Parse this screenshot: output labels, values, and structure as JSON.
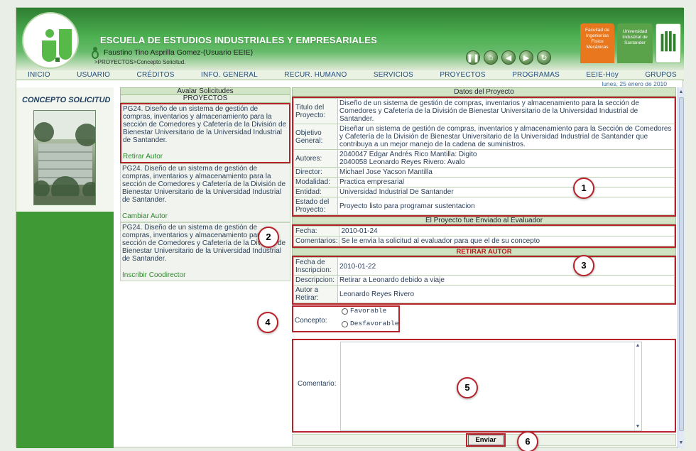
{
  "header": {
    "school_title": "ESCUELA DE ESTUDIOS INDUSTRIALES Y EMPRESARIALES",
    "user_line": "Faustino Tino Asprilla Gomez-(Usuario EEIE)",
    "breadcrumb": ">PROYECTOS>Concepto Solicitud.",
    "faculty_badge": "Facultad de Ingenierías Físico Mecánicas",
    "university_badge": "Universidad Industrial de Santander"
  },
  "menu": [
    "INICIO",
    "USUARIO",
    "CRÉDITOS",
    "INFO. GENERAL",
    "RECUR. HUMANO",
    "SERVICIOS",
    "PROYECTOS",
    "PROGRAMAS",
    "EEIE-Hoy",
    "GRUPOS"
  ],
  "date": "lunes, 25 enero de 2010",
  "sidebar": {
    "title": "CONCEPTO SOLICITUD"
  },
  "middle": {
    "header": "Avalar Solicitudes",
    "subheader": "PROYECTOS",
    "items": [
      {
        "text": "PG24. Diseño de un sistema de gestión de compras, inventarios y almacenamiento para la sección de Comedores y Cafetería de la División de Bienestar Universitario de la Universidad Industrial de Santander.",
        "link": "Retirar Autor"
      },
      {
        "text": "PG24. Diseño de un sistema de gestión de compras, inventarios y almacenamiento para la sección de Comedores y Cafetería de la División de Bienestar Universitario de la Universidad Industrial de Santander.",
        "link": "Cambiar Autor"
      },
      {
        "text": "PG24. Diseño de un sistema de gestión de compras, inventarios y almacenamiento para la sección de Comedores y Cafetería de la División de Bienestar Universitario de la Universidad Industrial de Santander.",
        "link": "Inscribir Coodirector"
      }
    ]
  },
  "project": {
    "header": "Datos del Proyecto",
    "rows": [
      {
        "label": "Titulo del Proyecto:",
        "value": "Diseño de un sistema de gestión de compras, inventarios y almacenamiento para la sección de Comedores y Cafetería de la División de Bienestar Universitario de la Universidad Industrial de Santander."
      },
      {
        "label": "Objetivo General:",
        "value": "Diseñar un sistema de gestión de compras, inventarios y almacenamiento para la Sección de Comedores y Cafetería de la División de Bienestar Universitario de la Universidad Industrial de Santander que contribuya a un mejor manejo de la cadena de suministros."
      },
      {
        "label": "Autores:",
        "value_lines": [
          "2040047 Edgar Andrés Rico Mantilla: Digito",
          "2040058 Leonardo Reyes Rivero: Avalo"
        ]
      },
      {
        "label": "Director:",
        "value": "Michael Jose Yacson Mantilla"
      },
      {
        "label": "Modalidad:",
        "value": "Practica empresarial"
      },
      {
        "label": "Entidad:",
        "value": "Universidad Industrial De Santander"
      },
      {
        "label": "Estado del Proyecto:",
        "value": "Proyecto listo para programar sustentacion"
      }
    ]
  },
  "evaluator": {
    "header": "El Proyecto fue Enviado al Evaluador",
    "fecha_label": "Fecha:",
    "fecha": "2010-01-24",
    "comentarios_label": "Comentarios:",
    "comentarios": "Se le envia la solicitud al evaluador para que el de su concepto"
  },
  "retirar": {
    "header": "RETIRAR AUTOR",
    "fecha_label": "Fecha de Inscripcion:",
    "fecha": "2010-01-22",
    "descripcion_label": "Descripcion:",
    "descripcion": "Retirar a Leonardo debido a viaje",
    "autor_label": "Autor a Retirar:",
    "autor": "Leonardo Reyes Rivero"
  },
  "concepto": {
    "label": "Concepto:",
    "options": [
      "Favorable",
      "Desfavorable"
    ]
  },
  "comentario": {
    "label": "Comentario:"
  },
  "submit": "Enviar",
  "markers": [
    "1",
    "2",
    "3",
    "4",
    "5",
    "6"
  ]
}
